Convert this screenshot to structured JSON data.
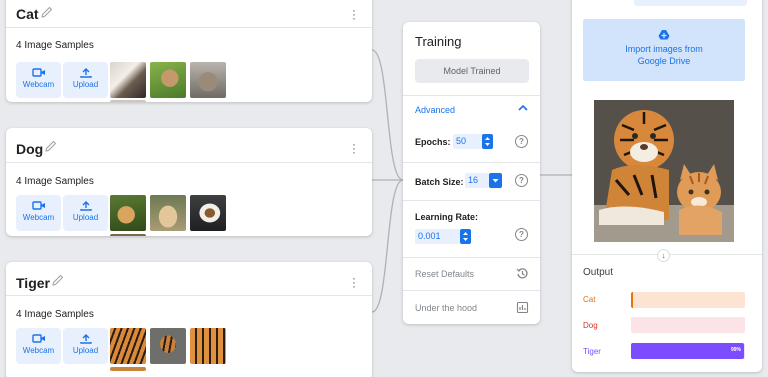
{
  "classes": [
    {
      "name": "Cat",
      "samples": "4 Image Samples",
      "webcam": "Webcam",
      "upload": "Upload"
    },
    {
      "name": "Dog",
      "samples": "4 Image Samples",
      "webcam": "Webcam",
      "upload": "Upload"
    },
    {
      "name": "Tiger",
      "samples": "4 Image Samples",
      "webcam": "Webcam",
      "upload": "Upload"
    }
  ],
  "training": {
    "title": "Training",
    "model_button": "Model Trained",
    "advanced": "Advanced",
    "epochs_label": "Epochs:",
    "epochs_value": "50",
    "batch_label": "Batch Size:",
    "batch_value": "16",
    "lr_label": "Learning Rate:",
    "lr_value": "0.001",
    "reset": "Reset Defaults",
    "under_hood": "Under the hood"
  },
  "preview": {
    "gdrive": "Import images from Google Drive",
    "output_title": "Output",
    "results": [
      {
        "label": "Cat",
        "confidence": 0.01,
        "color": "#e8710a",
        "bg": "#fde3d2"
      },
      {
        "label": "Dog",
        "confidence": 0.0,
        "color": "#d93025",
        "bg": "#fce4e6"
      },
      {
        "label": "Tiger",
        "confidence": 0.99,
        "color": "#7c4dff",
        "bg": "#e9e0ff",
        "pct_text": "99%"
      }
    ]
  },
  "colors": {
    "accent": "#1a73e8",
    "background": "#e8eaed"
  }
}
